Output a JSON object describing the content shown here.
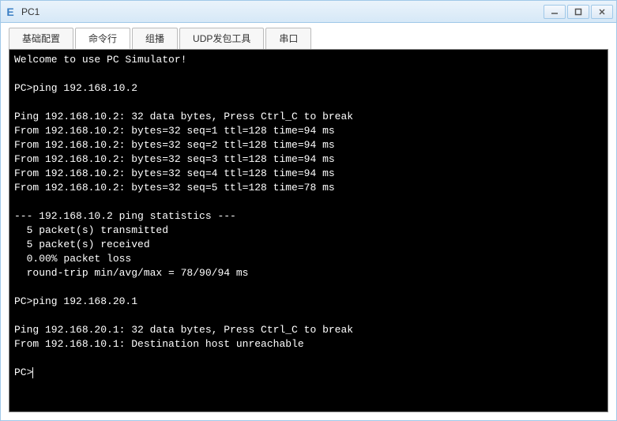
{
  "window": {
    "title": "PC1",
    "icon_glyph": "E"
  },
  "tabs": [
    {
      "label": "基础配置"
    },
    {
      "label": "命令行"
    },
    {
      "label": "组播"
    },
    {
      "label": "UDP发包工具"
    },
    {
      "label": "串口"
    }
  ],
  "active_tab_index": 1,
  "terminal": {
    "lines": [
      "Welcome to use PC Simulator!",
      "",
      "PC>ping 192.168.10.2",
      "",
      "Ping 192.168.10.2: 32 data bytes, Press Ctrl_C to break",
      "From 192.168.10.2: bytes=32 seq=1 ttl=128 time=94 ms",
      "From 192.168.10.2: bytes=32 seq=2 ttl=128 time=94 ms",
      "From 192.168.10.2: bytes=32 seq=3 ttl=128 time=94 ms",
      "From 192.168.10.2: bytes=32 seq=4 ttl=128 time=94 ms",
      "From 192.168.10.2: bytes=32 seq=5 ttl=128 time=78 ms",
      "",
      "--- 192.168.10.2 ping statistics ---",
      "  5 packet(s) transmitted",
      "  5 packet(s) received",
      "  0.00% packet loss",
      "  round-trip min/avg/max = 78/90/94 ms",
      "",
      "PC>ping 192.168.20.1",
      "",
      "Ping 192.168.20.1: 32 data bytes, Press Ctrl_C to break",
      "From 192.168.10.1: Destination host unreachable",
      "",
      "PC>"
    ]
  }
}
